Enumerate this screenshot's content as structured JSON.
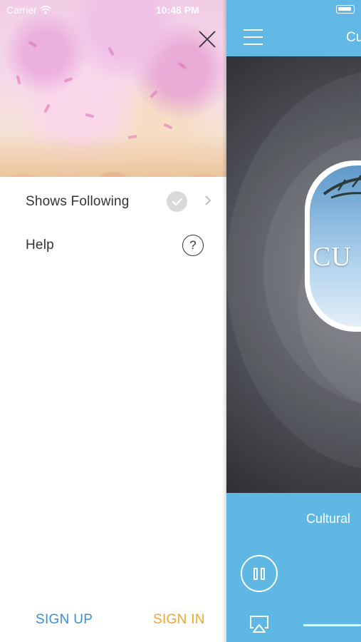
{
  "status_bar": {
    "carrier": "Carrier",
    "time": "10:48 PM"
  },
  "drawer": {
    "menu": [
      {
        "label": "Shows Following",
        "icon": "checkmark-circle-icon",
        "has_chevron": true
      },
      {
        "label": "Help",
        "icon": "question-circle-icon",
        "has_chevron": false
      }
    ],
    "sign_up_label": "SIGN UP",
    "sign_in_label": "SIGN IN",
    "colors": {
      "sign_up": "#3a8fd6",
      "sign_in": "#f0a52a"
    }
  },
  "player": {
    "title": "Cu",
    "album_text": "CU",
    "track_name": "Cultural",
    "colors": {
      "accent": "#5db6e4"
    }
  }
}
